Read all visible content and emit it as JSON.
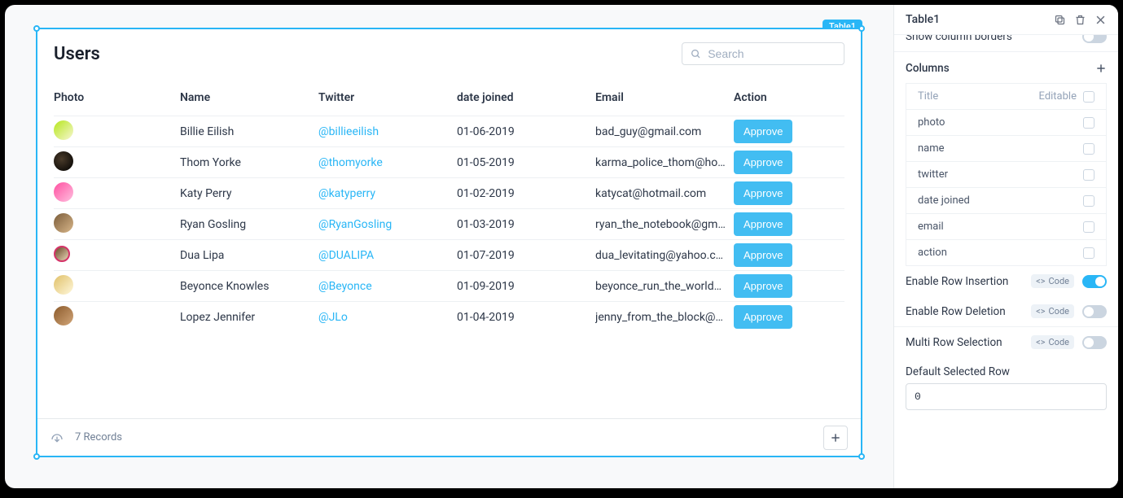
{
  "widget_tag": "Table1",
  "table": {
    "title": "Users",
    "search_placeholder": "Search",
    "columns": [
      "Photo",
      "Name",
      "Twitter",
      "date joined",
      "Email",
      "Action"
    ],
    "rows": [
      {
        "name": "Billie Eilish",
        "twitter": "@billieeilish",
        "date_joined": "01-06-2019",
        "email": "bad_guy@gmail.com",
        "action": "Approve"
      },
      {
        "name": "Thom Yorke",
        "twitter": "@thomyorke",
        "date_joined": "01-05-2019",
        "email": "karma_police_thom@hotmail.com",
        "action": "Approve"
      },
      {
        "name": "Katy Perry",
        "twitter": "@katyperry",
        "date_joined": "01-02-2019",
        "email": "katycat@hotmail.com",
        "action": "Approve"
      },
      {
        "name": "Ryan Gosling",
        "twitter": "@RyanGosling",
        "date_joined": "01-03-2019",
        "email": "ryan_the_notebook@gmail.com",
        "action": "Approve"
      },
      {
        "name": "Dua Lipa",
        "twitter": "@DUALIPA",
        "date_joined": "01-07-2019",
        "email": "dua_levitating@yahoo.com",
        "action": "Approve"
      },
      {
        "name": "Beyonce Knowles",
        "twitter": "@Beyonce",
        "date_joined": "01-09-2019",
        "email": "beyonce_run_the_world@gmail.com",
        "action": "Approve"
      },
      {
        "name": "Lopez Jennifer",
        "twitter": "@JLo",
        "date_joined": "01-04-2019",
        "email": "jenny_from_the_block@yahoo.com",
        "action": "Approve"
      }
    ],
    "footer_records": "7 Records"
  },
  "panel": {
    "title": "Table1",
    "show_column_borders_label": "Show column borders",
    "columns_label": "Columns",
    "col_header_title": "Title",
    "col_header_editable": "Editable",
    "column_items": [
      "photo",
      "name",
      "twitter",
      "date joined",
      "email",
      "action"
    ],
    "enable_row_insertion": "Enable Row Insertion",
    "enable_row_deletion": "Enable Row Deletion",
    "multi_row_selection": "Multi Row Selection",
    "default_selected_row": "Default Selected Row",
    "default_selected_row_value": "0",
    "code_label": "Code"
  }
}
